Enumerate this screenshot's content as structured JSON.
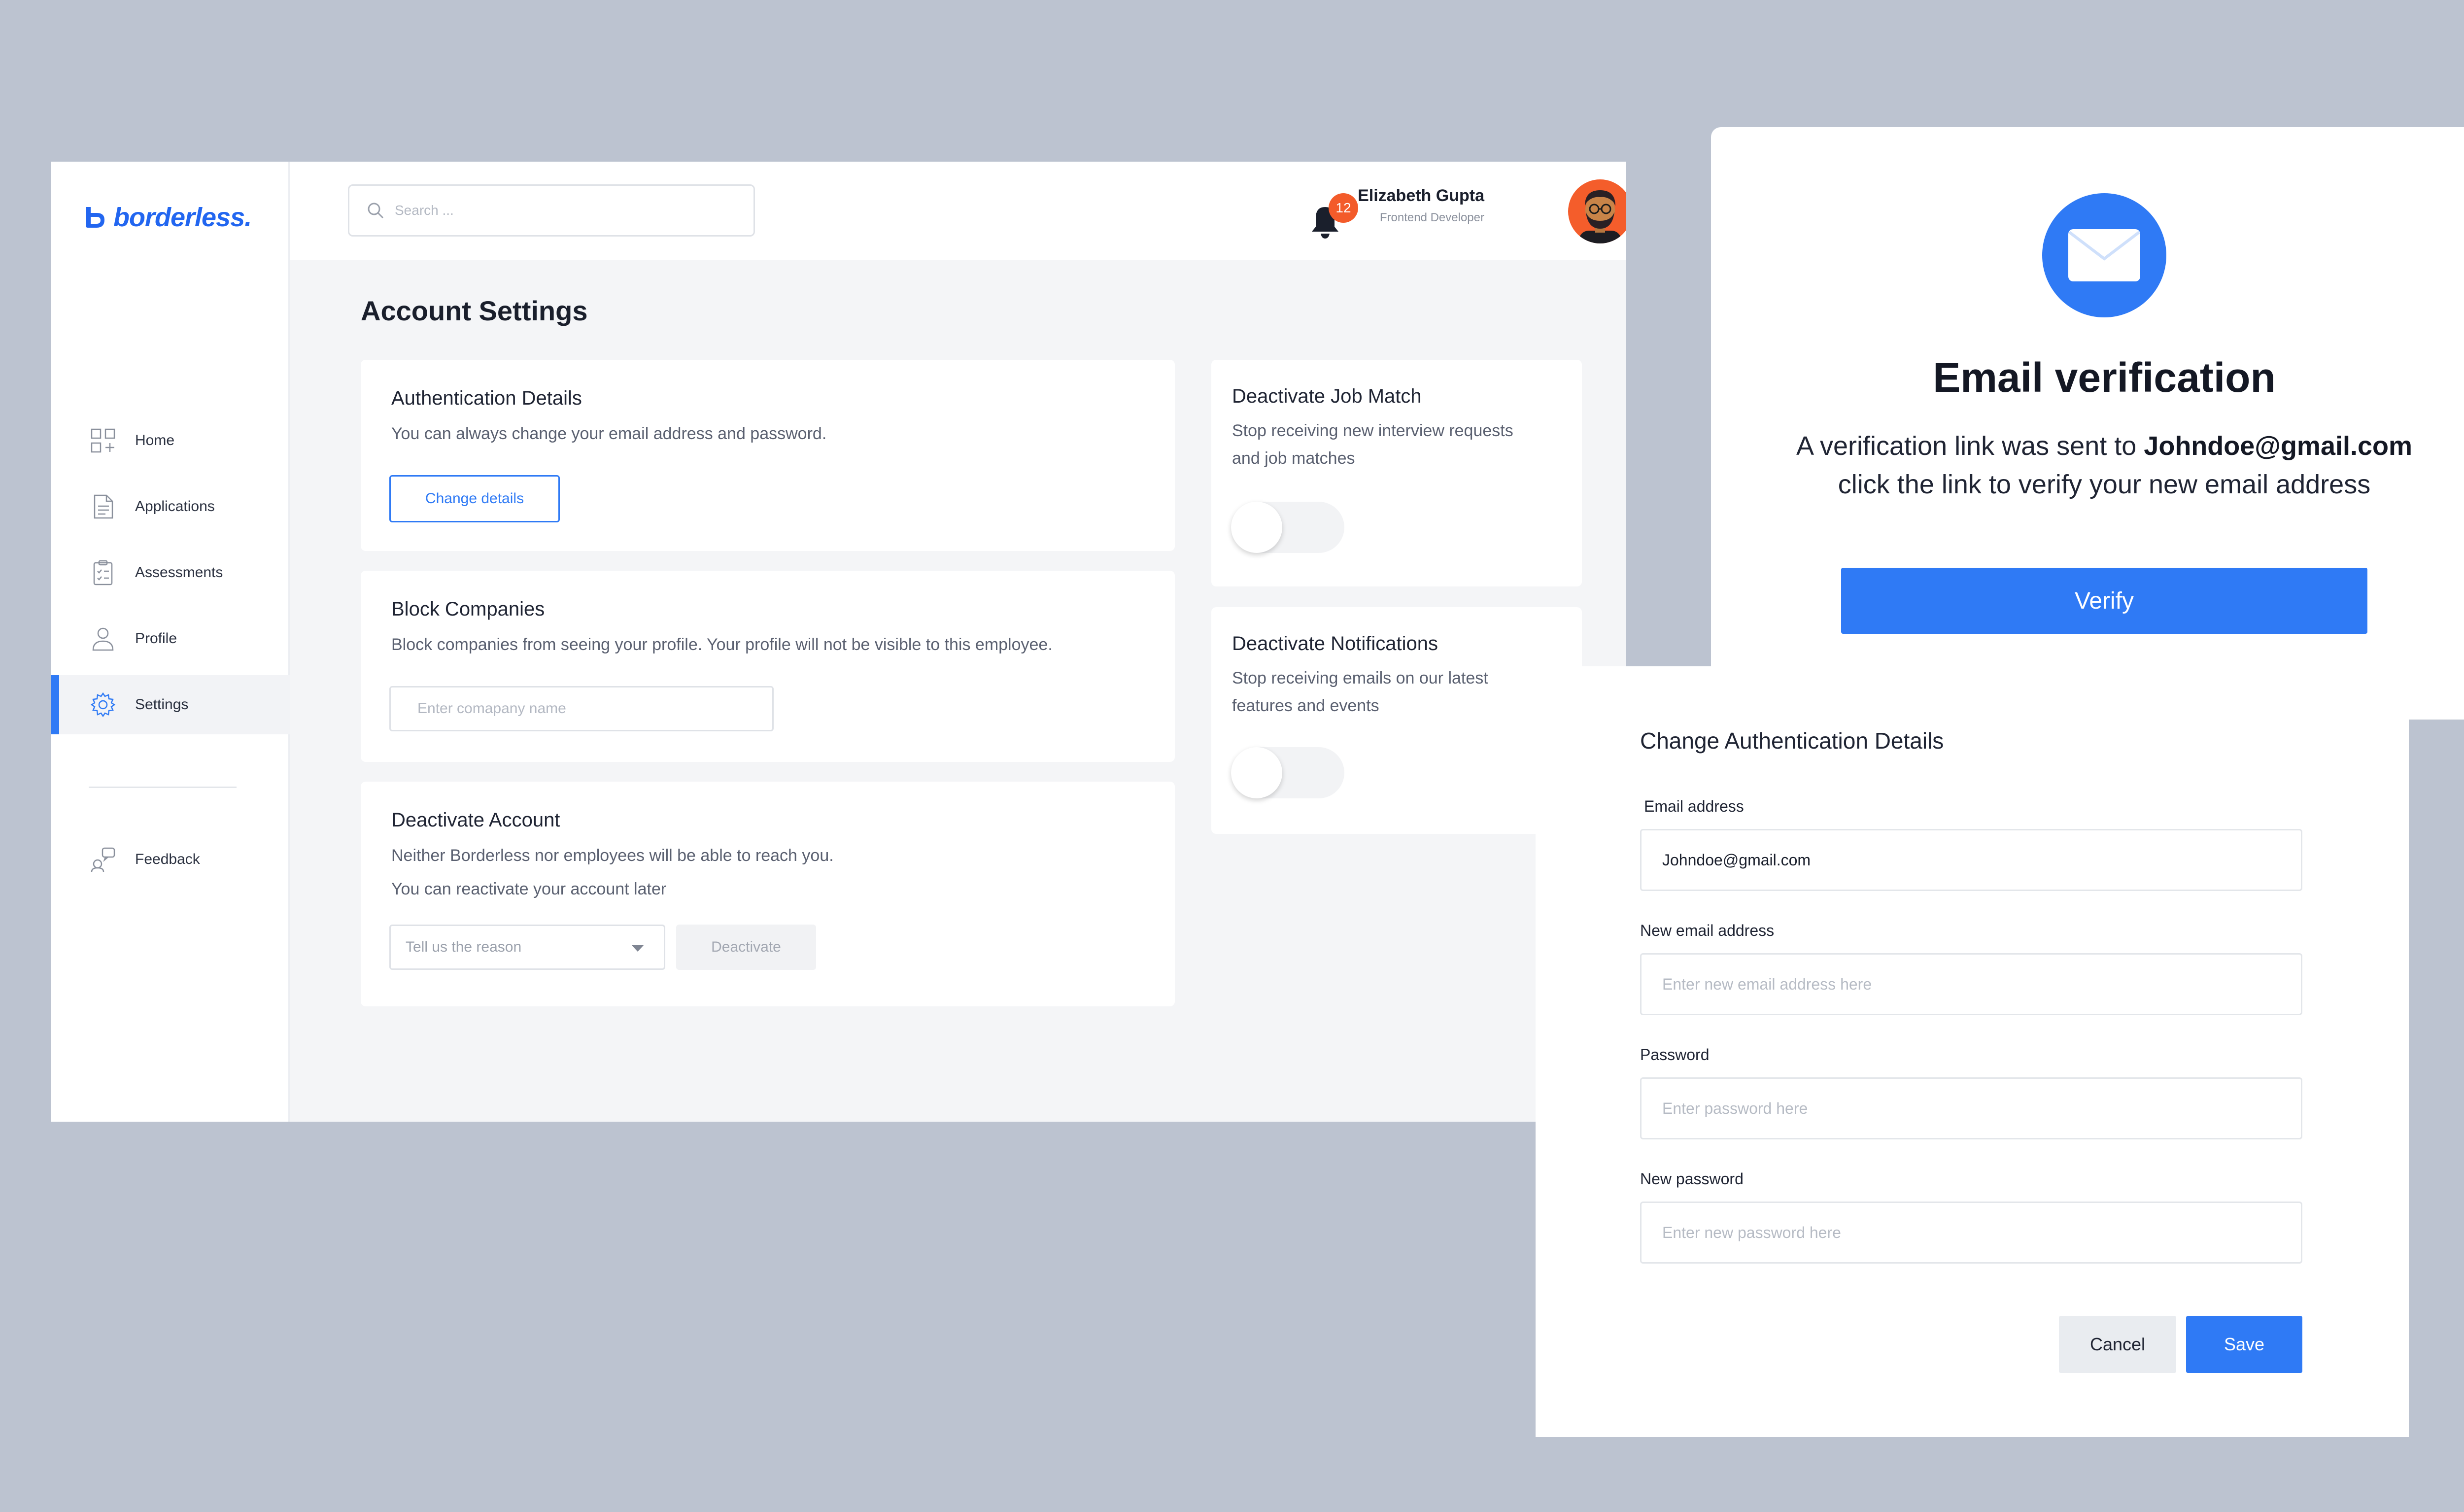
{
  "brand": {
    "name": "borderless.",
    "color": "#2266f0"
  },
  "sidebar": {
    "items": [
      {
        "label": "Home",
        "icon": "grid-icon",
        "active": false
      },
      {
        "label": "Applications",
        "icon": "document-icon",
        "active": false
      },
      {
        "label": "Assessments",
        "icon": "clipboard-icon",
        "active": false
      },
      {
        "label": "Profile",
        "icon": "user-icon",
        "active": false
      },
      {
        "label": "Settings",
        "icon": "gear-icon",
        "active": true
      }
    ],
    "feedback": {
      "label": "Feedback",
      "icon": "feedback-icon"
    }
  },
  "topbar": {
    "search_placeholder": "Search ...",
    "notifications_count": "12",
    "user": {
      "name": "Elizabeth Gupta",
      "role": "Frontend Developer"
    }
  },
  "page": {
    "title": "Account Settings",
    "auth_details": {
      "title": "Authentication Details",
      "description": "You can always change your email address and password.",
      "button": "Change details"
    },
    "block_companies": {
      "title": "Block Companies",
      "description": "Block companies from seeing your profile. Your profile will not be visible to this employee.",
      "placeholder": "Enter comapany name"
    },
    "deactivate_account": {
      "title": "Deactivate Account",
      "line1": "Neither Borderless nor employees will be able to reach you.",
      "line2": "You can reactivate your account later",
      "select_placeholder": "Tell us the reason",
      "button": "Deactivate"
    },
    "deactivate_job_match": {
      "title": "Deactivate Job Match",
      "line1": "Stop receiving new interview requests",
      "line2": "and job matches",
      "enabled": false
    },
    "deactivate_notifications": {
      "title": "Deactivate Notifications",
      "line1": "Stop receiving emails on our latest",
      "line2": "features and events",
      "enabled": false
    }
  },
  "verification": {
    "title": "Email verification",
    "text_prefix": "A verification link was sent to ",
    "email": "Johndoe@gmail.com",
    "text_line2": "click the link to verify your new email address",
    "button": "Verify"
  },
  "change_auth": {
    "title": "Change Authentication Details",
    "email_label": "Email address",
    "email_value": "Johndoe@gmail.com",
    "new_email_label": "New email address",
    "new_email_placeholder": "Enter new email address here",
    "password_label": "Password",
    "password_placeholder": "Enter password here",
    "new_password_label": "New password",
    "new_password_placeholder": "Enter new password here",
    "cancel": "Cancel",
    "save": "Save"
  },
  "colors": {
    "accent": "#2f7af5",
    "badge": "#f35b2a",
    "background": "#bcc3d0"
  }
}
